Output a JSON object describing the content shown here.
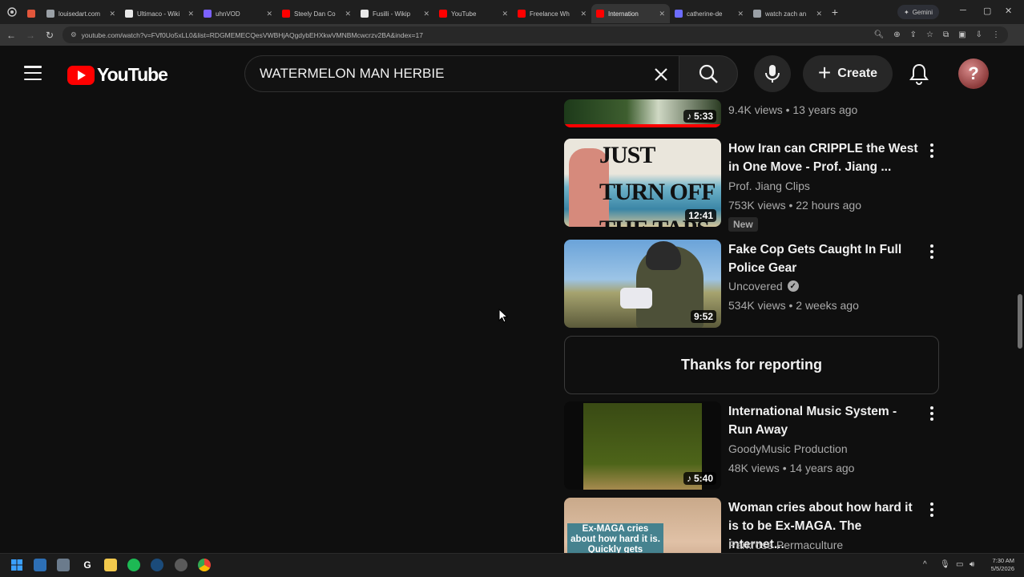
{
  "browser": {
    "tabs": [
      {
        "title": "",
        "fav": "#888888"
      },
      {
        "title": "",
        "fav": "#e2563b"
      },
      {
        "title": "louisedart.com",
        "fav": "#9aa0a6"
      },
      {
        "title": "Ultimaco - Wiki",
        "fav": "#e8e8e8"
      },
      {
        "title": "uhnVOD",
        "fav": "#7b61ff"
      },
      {
        "title": "Steely Dan Co",
        "fav": "#ff0000"
      },
      {
        "title": "Fusilli - Wikip",
        "fav": "#e8e8e8"
      },
      {
        "title": "YouTube",
        "fav": "#ff0000"
      },
      {
        "title": "Freelance Wh",
        "fav": "#ff0000"
      },
      {
        "title": "Internation",
        "fav": "#ff0000"
      },
      {
        "title": "catherine-de",
        "fav": "#6c6cff"
      },
      {
        "title": "watch zach an",
        "fav": "#9aa0a6"
      }
    ],
    "gemini_label": "Gemini",
    "url": "youtube.com/watch?v=FVf0Uo5xLL0&list=RDGMEMECQesVWBHjAQgdybEHXkwVMNBMcwcrzv2BA&index=17"
  },
  "header": {
    "logo_text": "YouTube",
    "search_value": "WATERMELON MAN HERBIE",
    "create_label": "Create",
    "avatar_text": "?"
  },
  "related": [
    {
      "title": "",
      "channel": "",
      "views": "9.4K views • 13 years ago",
      "duration": "5:33",
      "music": true
    },
    {
      "title": "How Iran can CRIPPLE the West in One Move - Prof. Jiang ...",
      "channel": "Prof. Jiang Clips",
      "views": "753K views • 22 hours ago",
      "duration": "12:41",
      "badge": "New",
      "thumb_text": "JUST TURN OFF THE TAPS"
    },
    {
      "title": "Fake Cop Gets Caught In Full Police Gear",
      "channel": "Uncovered",
      "views": "534K views • 2 weeks ago",
      "duration": "9:52",
      "verified": true
    },
    {
      "title": "International Music System - Run Away",
      "channel": "GoodyMusic Production",
      "views": "48K views • 14 years ago",
      "duration": "5:40",
      "music": true
    },
    {
      "title": "Woman cries about how hard it is to be Ex-MAGA. The internet...",
      "channel": "Parkrose Permaculture",
      "views": "",
      "thumb_text": "Ex-MAGA cries about how hard it is. Quickly gets dragged"
    }
  ],
  "reported_text": "Thanks for reporting",
  "taskbar": {
    "time": "7:30 AM",
    "date": "5/5/2026"
  }
}
